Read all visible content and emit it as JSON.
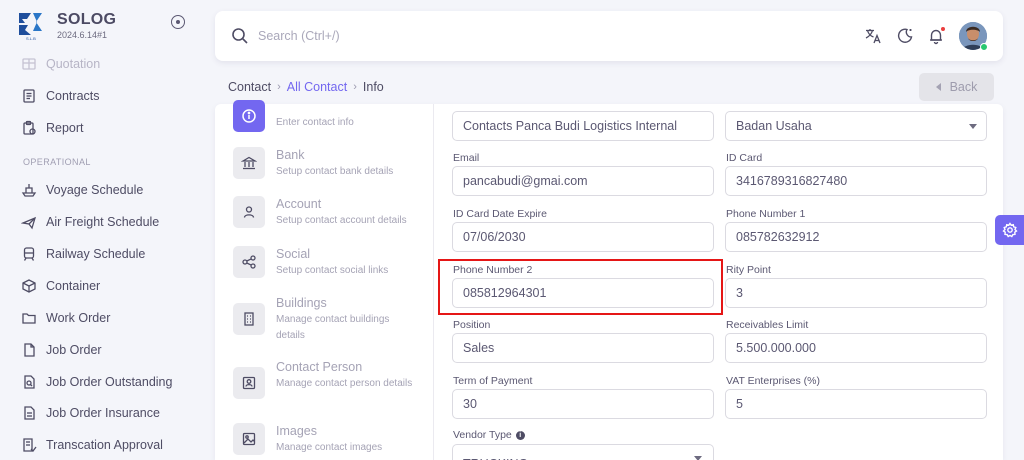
{
  "brand": {
    "name": "SOLOG",
    "version": "2024.6.14#1",
    "logo_tag": "S.L.B"
  },
  "sidebar": {
    "items_top": [
      {
        "label": "Quotation",
        "icon": "quotation-icon"
      },
      {
        "label": "Contracts",
        "icon": "contracts-icon"
      },
      {
        "label": "Report",
        "icon": "report-icon"
      }
    ],
    "section_operational": "OPERATIONAL",
    "items_operational": [
      {
        "label": "Voyage Schedule",
        "icon": "ship-icon"
      },
      {
        "label": "Air Freight Schedule",
        "icon": "plane-icon"
      },
      {
        "label": "Railway Schedule",
        "icon": "train-icon"
      },
      {
        "label": "Container",
        "icon": "box-icon"
      },
      {
        "label": "Work Order",
        "icon": "folder-icon"
      },
      {
        "label": "Job Order",
        "icon": "file-icon"
      },
      {
        "label": "Job Order Outstanding",
        "icon": "file-search-icon"
      },
      {
        "label": "Job Order Insurance",
        "icon": "file-text-icon"
      },
      {
        "label": "Transcation Approval",
        "icon": "file-check-icon"
      }
    ]
  },
  "search": {
    "placeholder": "Search (Ctrl+/)"
  },
  "breadcrumb": {
    "root": "Contact",
    "middle": "All Contact",
    "current": "Info"
  },
  "actions": {
    "back_label": "Back"
  },
  "steps": [
    {
      "title": "",
      "desc": "Enter contact info",
      "icon": "info-icon",
      "active": true
    },
    {
      "title": "Bank",
      "desc": "Setup contact bank details",
      "icon": "bank-icon"
    },
    {
      "title": "Account",
      "desc": "Setup contact account details",
      "icon": "user-icon"
    },
    {
      "title": "Social",
      "desc": "Setup contact social links",
      "icon": "share-icon"
    },
    {
      "title": "Buildings",
      "desc": "Manage contact buildings details",
      "icon": "building-icon"
    },
    {
      "title": "Contact Person",
      "desc": "Manage contact person details",
      "icon": "contact-card-icon"
    },
    {
      "title": "Images",
      "desc": "Manage contact images",
      "icon": "image-icon"
    }
  ],
  "form": {
    "company_name": {
      "value": "Contacts Panca Budi Logistics Internal"
    },
    "business_entity": {
      "value": "Badan Usaha"
    },
    "email": {
      "label": "Email",
      "value": "pancabudi@gmai.com"
    },
    "id_card": {
      "label": "ID Card",
      "value": "3416789316827480"
    },
    "id_card_expire": {
      "label": "ID Card Date Expire",
      "value": "07/06/2030"
    },
    "phone_1": {
      "label": "Phone Number 1",
      "value": "085782632912"
    },
    "phone_2": {
      "label": "Phone Number 2",
      "value": "085812964301"
    },
    "rity_point": {
      "label": "Rity Point",
      "value": "3"
    },
    "position": {
      "label": "Position",
      "value": "Sales"
    },
    "receivables_limit": {
      "label": "Receivables Limit",
      "value": "5.500.000.000"
    },
    "term_of_payment": {
      "label": "Term of Payment",
      "value": "30"
    },
    "vat_enterprises": {
      "label": "VAT Enterprises (%)",
      "value": "5"
    },
    "vendor_type": {
      "label": "Vendor Type",
      "value": "TRUCKING"
    }
  },
  "colors": {
    "accent": "#7367f0",
    "highlight": "#e51616",
    "notification": "#ea3e3e",
    "online": "#28c76f"
  }
}
